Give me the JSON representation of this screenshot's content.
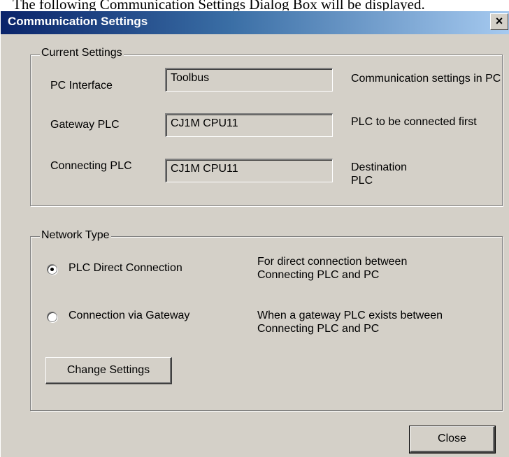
{
  "document": {
    "caption": "The following Communication Settings Dialog Box will be displayed."
  },
  "dialog": {
    "title": "Communication Settings",
    "close_glyph": "×"
  },
  "current_settings": {
    "legend": "Current Settings",
    "rows": [
      {
        "label": "PC Interface",
        "value": "Toolbus",
        "desc": "Communication settings in PC"
      },
      {
        "label": "Gateway PLC",
        "value": "CJ1M CPU11",
        "desc": "PLC to be connected first"
      },
      {
        "label": "Connecting PLC",
        "value": "CJ1M CPU11",
        "desc": "Destination PLC"
      }
    ]
  },
  "network_type": {
    "legend": "Network Type",
    "options": [
      {
        "label": "PLC Direct Connection",
        "desc": "For direct connection between Connecting PLC and PC",
        "selected": true
      },
      {
        "label": "Connection via Gateway",
        "desc": "When a gateway PLC exists between Connecting PLC and PC",
        "selected": false
      }
    ],
    "change_button": "Change Settings"
  },
  "footer": {
    "close_button": "Close"
  }
}
